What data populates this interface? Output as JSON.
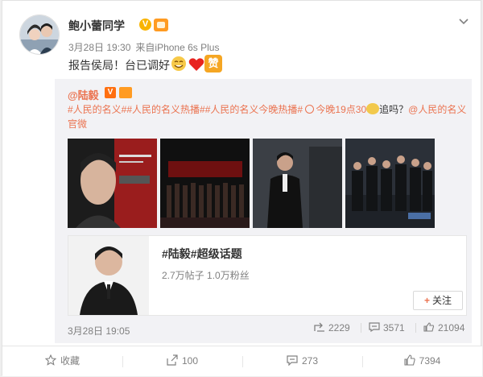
{
  "post": {
    "author": "鲍小蕾同学",
    "time": "3月28日 19:30",
    "via_prefix": "来自",
    "device": "iPhone 6s Plus",
    "text": "报告侯局！台已调好",
    "emoji_zan": "赞"
  },
  "repost": {
    "author": "@陆毅",
    "tags": [
      "#人民的名义#",
      "#人民的名义热播#",
      "#人民的名义今晚热播#"
    ],
    "link_text": "今晚19点30",
    "suffix": "追吗？",
    "mention": "@人民的名义官微",
    "pictures": [
      "poster-luyi",
      "stage-cast",
      "actor-suit",
      "cast-photo"
    ],
    "topic": {
      "title": "#陆毅#超级话题",
      "posts": "2.7万帖子",
      "fans": "1.0万粉丝",
      "follow_label": "关注"
    },
    "date": "3月28日 19:05",
    "reposts": "2229",
    "comments": "3571",
    "likes": "21094"
  },
  "actions": {
    "favorite": "收藏",
    "repost": "100",
    "comment": "273",
    "like": "7394"
  },
  "colors": {
    "link": "#eb7350",
    "muted": "#808080",
    "repost_bg": "#f2f2f5"
  }
}
